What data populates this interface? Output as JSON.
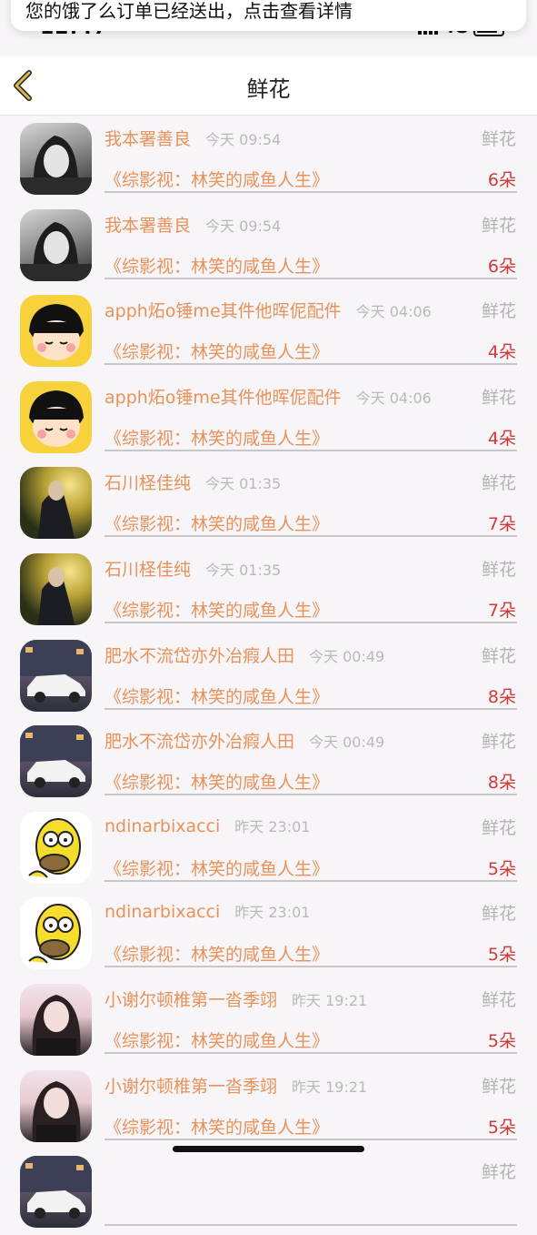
{
  "notification": {
    "text": "您的饿了么订单已经送出，点击查看详情"
  },
  "status_bar": {
    "time": "12:47",
    "network": "4G"
  },
  "nav": {
    "title": "鲜花"
  },
  "rows": [
    {
      "avatar": "girl-bw-avatar",
      "name": "我本署善良",
      "time": "今天 09:54",
      "type": "鲜花",
      "book": "《综影视：林笑的咸鱼人生》",
      "count": "6朵"
    },
    {
      "avatar": "girl-bw-avatar",
      "name": "我本署善良",
      "time": "今天 09:54",
      "type": "鲜花",
      "book": "《综影视：林笑的咸鱼人生》",
      "count": "6朵"
    },
    {
      "avatar": "maruko-avatar",
      "name": "apph炻o锤me其件他晖伲配件",
      "time": "今天 04:06",
      "type": "鲜花",
      "book": "《综影视：林笑的咸鱼人生》",
      "count": "4朵"
    },
    {
      "avatar": "maruko-avatar",
      "name": "apph炻o锤me其件他晖伲配件",
      "time": "今天 04:06",
      "type": "鲜花",
      "book": "《综影视：林笑的咸鱼人生》",
      "count": "4朵"
    },
    {
      "avatar": "guy-avatar",
      "name": "石川柽佳纯",
      "time": "今天 01:35",
      "type": "鲜花",
      "book": "《综影视：林笑的咸鱼人生》",
      "count": "7朵"
    },
    {
      "avatar": "guy-avatar",
      "name": "石川柽佳纯",
      "time": "今天 01:35",
      "type": "鲜花",
      "book": "《综影视：林笑的咸鱼人生》",
      "count": "7朵"
    },
    {
      "avatar": "car-avatar",
      "name": "肥水不流岱亦外冶瘕人田",
      "time": "今天 00:49",
      "type": "鲜花",
      "book": "《综影视：林笑的咸鱼人生》",
      "count": "8朵"
    },
    {
      "avatar": "car-avatar",
      "name": "肥水不流岱亦外冶瘕人田",
      "time": "今天 00:49",
      "type": "鲜花",
      "book": "《综影视：林笑的咸鱼人生》",
      "count": "8朵"
    },
    {
      "avatar": "homer-avatar",
      "name": "ndinarbixacci",
      "time": "昨天 23:01",
      "type": "鲜花",
      "book": "《综影视：林笑的咸鱼人生》",
      "count": "5朵"
    },
    {
      "avatar": "homer-avatar",
      "name": "ndinarbixacci",
      "time": "昨天 23:01",
      "type": "鲜花",
      "book": "《综影视：林笑的咸鱼人生》",
      "count": "5朵"
    },
    {
      "avatar": "lady-avatar",
      "name": "小谢尔顿椎第一沓季翊",
      "time": "昨天 19:21",
      "type": "鲜花",
      "book": "《综影视：林笑的咸鱼人生》",
      "count": "5朵"
    },
    {
      "avatar": "lady-avatar",
      "name": "小谢尔顿椎第一沓季翊",
      "time": "昨天 19:21",
      "type": "鲜花",
      "book": "《综影视：林笑的咸鱼人生》",
      "count": "5朵"
    },
    {
      "avatar": "car-avatar",
      "name": "",
      "time": "",
      "type": "鲜花",
      "book": "",
      "count": ""
    }
  ]
}
